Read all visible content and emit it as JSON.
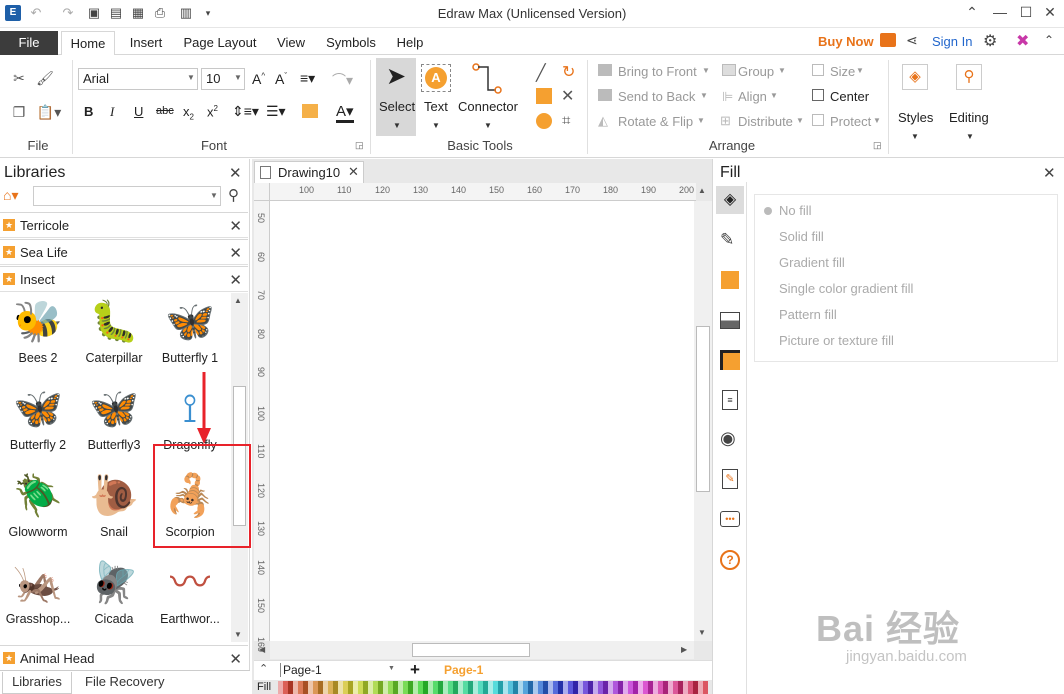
{
  "window": {
    "title": "Edraw Max (Unlicensed Version)"
  },
  "menu": {
    "file": "File",
    "tabs": [
      "Home",
      "Insert",
      "Page Layout",
      "View",
      "Symbols",
      "Help"
    ],
    "buy_now": "Buy Now",
    "sign_in": "Sign In"
  },
  "ribbon": {
    "groups": {
      "file": "File",
      "font": "Font",
      "basic_tools": "Basic Tools",
      "arrange": "Arrange"
    },
    "font_name": "Arial",
    "font_size": "10",
    "select": "Select",
    "text": "Text",
    "connector": "Connector",
    "bring_to_front": "Bring to Front",
    "send_to_back": "Send to Back",
    "rotate_flip": "Rotate & Flip",
    "group": "Group",
    "align": "Align",
    "distribute": "Distribute",
    "size": "Size",
    "center": "Center",
    "protect": "Protect",
    "styles": "Styles",
    "editing": "Editing"
  },
  "libraries": {
    "title": "Libraries",
    "categories": [
      "Terricole",
      "Sea Life",
      "Insect"
    ],
    "shapes": [
      {
        "label": "Bees 2",
        "color": "#e8b020"
      },
      {
        "label": "Caterpillar",
        "color": "#7cb83a"
      },
      {
        "label": "Butterfly 1",
        "color": "#8ccf5a"
      },
      {
        "label": "Butterfly 2",
        "color": "#2a9fd8"
      },
      {
        "label": "Butterfly3",
        "color": "#3a78c8"
      },
      {
        "label": "Dragonfly",
        "color": "#3a8fd0"
      },
      {
        "label": "Glowworm",
        "color": "#8a5a20"
      },
      {
        "label": "Snail",
        "color": "#e8a030"
      },
      {
        "label": "Scorpion",
        "color": "#5a8a30"
      },
      {
        "label": "Grasshop...",
        "color": "#5ab040"
      },
      {
        "label": "Cicada",
        "color": "#d8a030"
      },
      {
        "label": "Earthwor...",
        "color": "#c05040"
      }
    ],
    "bottom_category": "Animal Head",
    "bottom_tabs": [
      "Libraries",
      "File Recovery"
    ]
  },
  "document": {
    "tab": "Drawing10",
    "ruler_h": [
      "100",
      "110",
      "120",
      "130",
      "140",
      "150",
      "160",
      "170",
      "180",
      "190",
      "200"
    ],
    "ruler_v": [
      "50",
      "60",
      "70",
      "80",
      "90",
      "100",
      "110",
      "120",
      "130",
      "140",
      "150",
      "160"
    ],
    "page_select": "Page-1",
    "page_tab": "Page-1",
    "fill_label": "Fill"
  },
  "fill_panel": {
    "title": "Fill",
    "options": [
      "No fill",
      "Solid fill",
      "Gradient fill",
      "Single color gradient fill",
      "Pattern fill",
      "Picture or texture fill"
    ]
  },
  "watermark": {
    "text": "Bai 经验",
    "url": "jingyan.baidu.com"
  }
}
